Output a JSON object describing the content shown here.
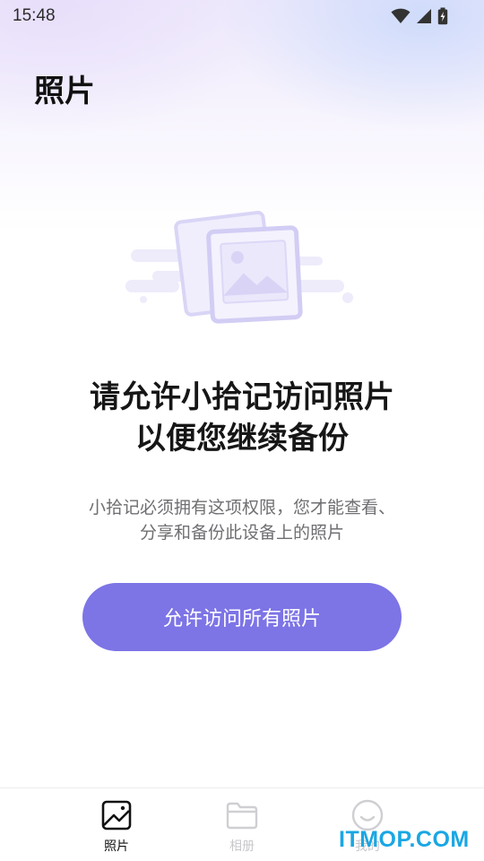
{
  "status_bar": {
    "time": "15:48",
    "icons": [
      "wifi-icon",
      "cell-signal-icon",
      "battery-charging-icon"
    ]
  },
  "header": {
    "title": "照片"
  },
  "empty_state": {
    "illustration": "photo-stack-icon",
    "headline_line1": "请允许小拾记访问照片",
    "headline_line2": "以便您继续备份",
    "description_line1": "小拾记必须拥有这项权限，您才能查看、",
    "description_line2": "分享和备份此设备上的照片",
    "button_label": "允许访问所有照片"
  },
  "tabs": [
    {
      "label": "照片",
      "icon": "photo-icon",
      "active": true
    },
    {
      "label": "相册",
      "icon": "folder-icon",
      "active": false
    },
    {
      "label": "我的",
      "icon": "smiley-icon",
      "active": false
    }
  ],
  "watermark": "ITMOP.COM",
  "colors": {
    "accent": "#7d74e6",
    "tab_active": "#111111",
    "tab_inactive": "#c8c8cc",
    "watermark": "#1aa7e3"
  }
}
